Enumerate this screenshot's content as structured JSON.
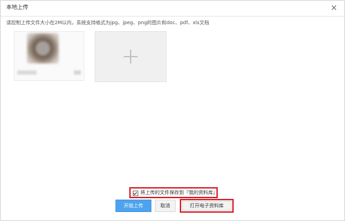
{
  "window": {
    "title": "本地上传",
    "close_label": "×"
  },
  "upload": {
    "hint": "请控制上传文件大小在2M以内，系统支持格式为jpg、jpeg、png的图片和doc、pdf、xls文档",
    "thumbnail_icon": "uploaded-image-thumbnail",
    "add_icon": "plus-icon"
  },
  "options": {
    "save_to_library_label": "将上传的文件保存到『我的资料库』",
    "save_to_library_checked": true
  },
  "buttons": {
    "start_upload_label": "开始上传",
    "cancel_label": "取消",
    "open_library_label": "打开电子资料库"
  },
  "colors": {
    "primary": "#4da3ee",
    "highlight": "#d8232a"
  }
}
